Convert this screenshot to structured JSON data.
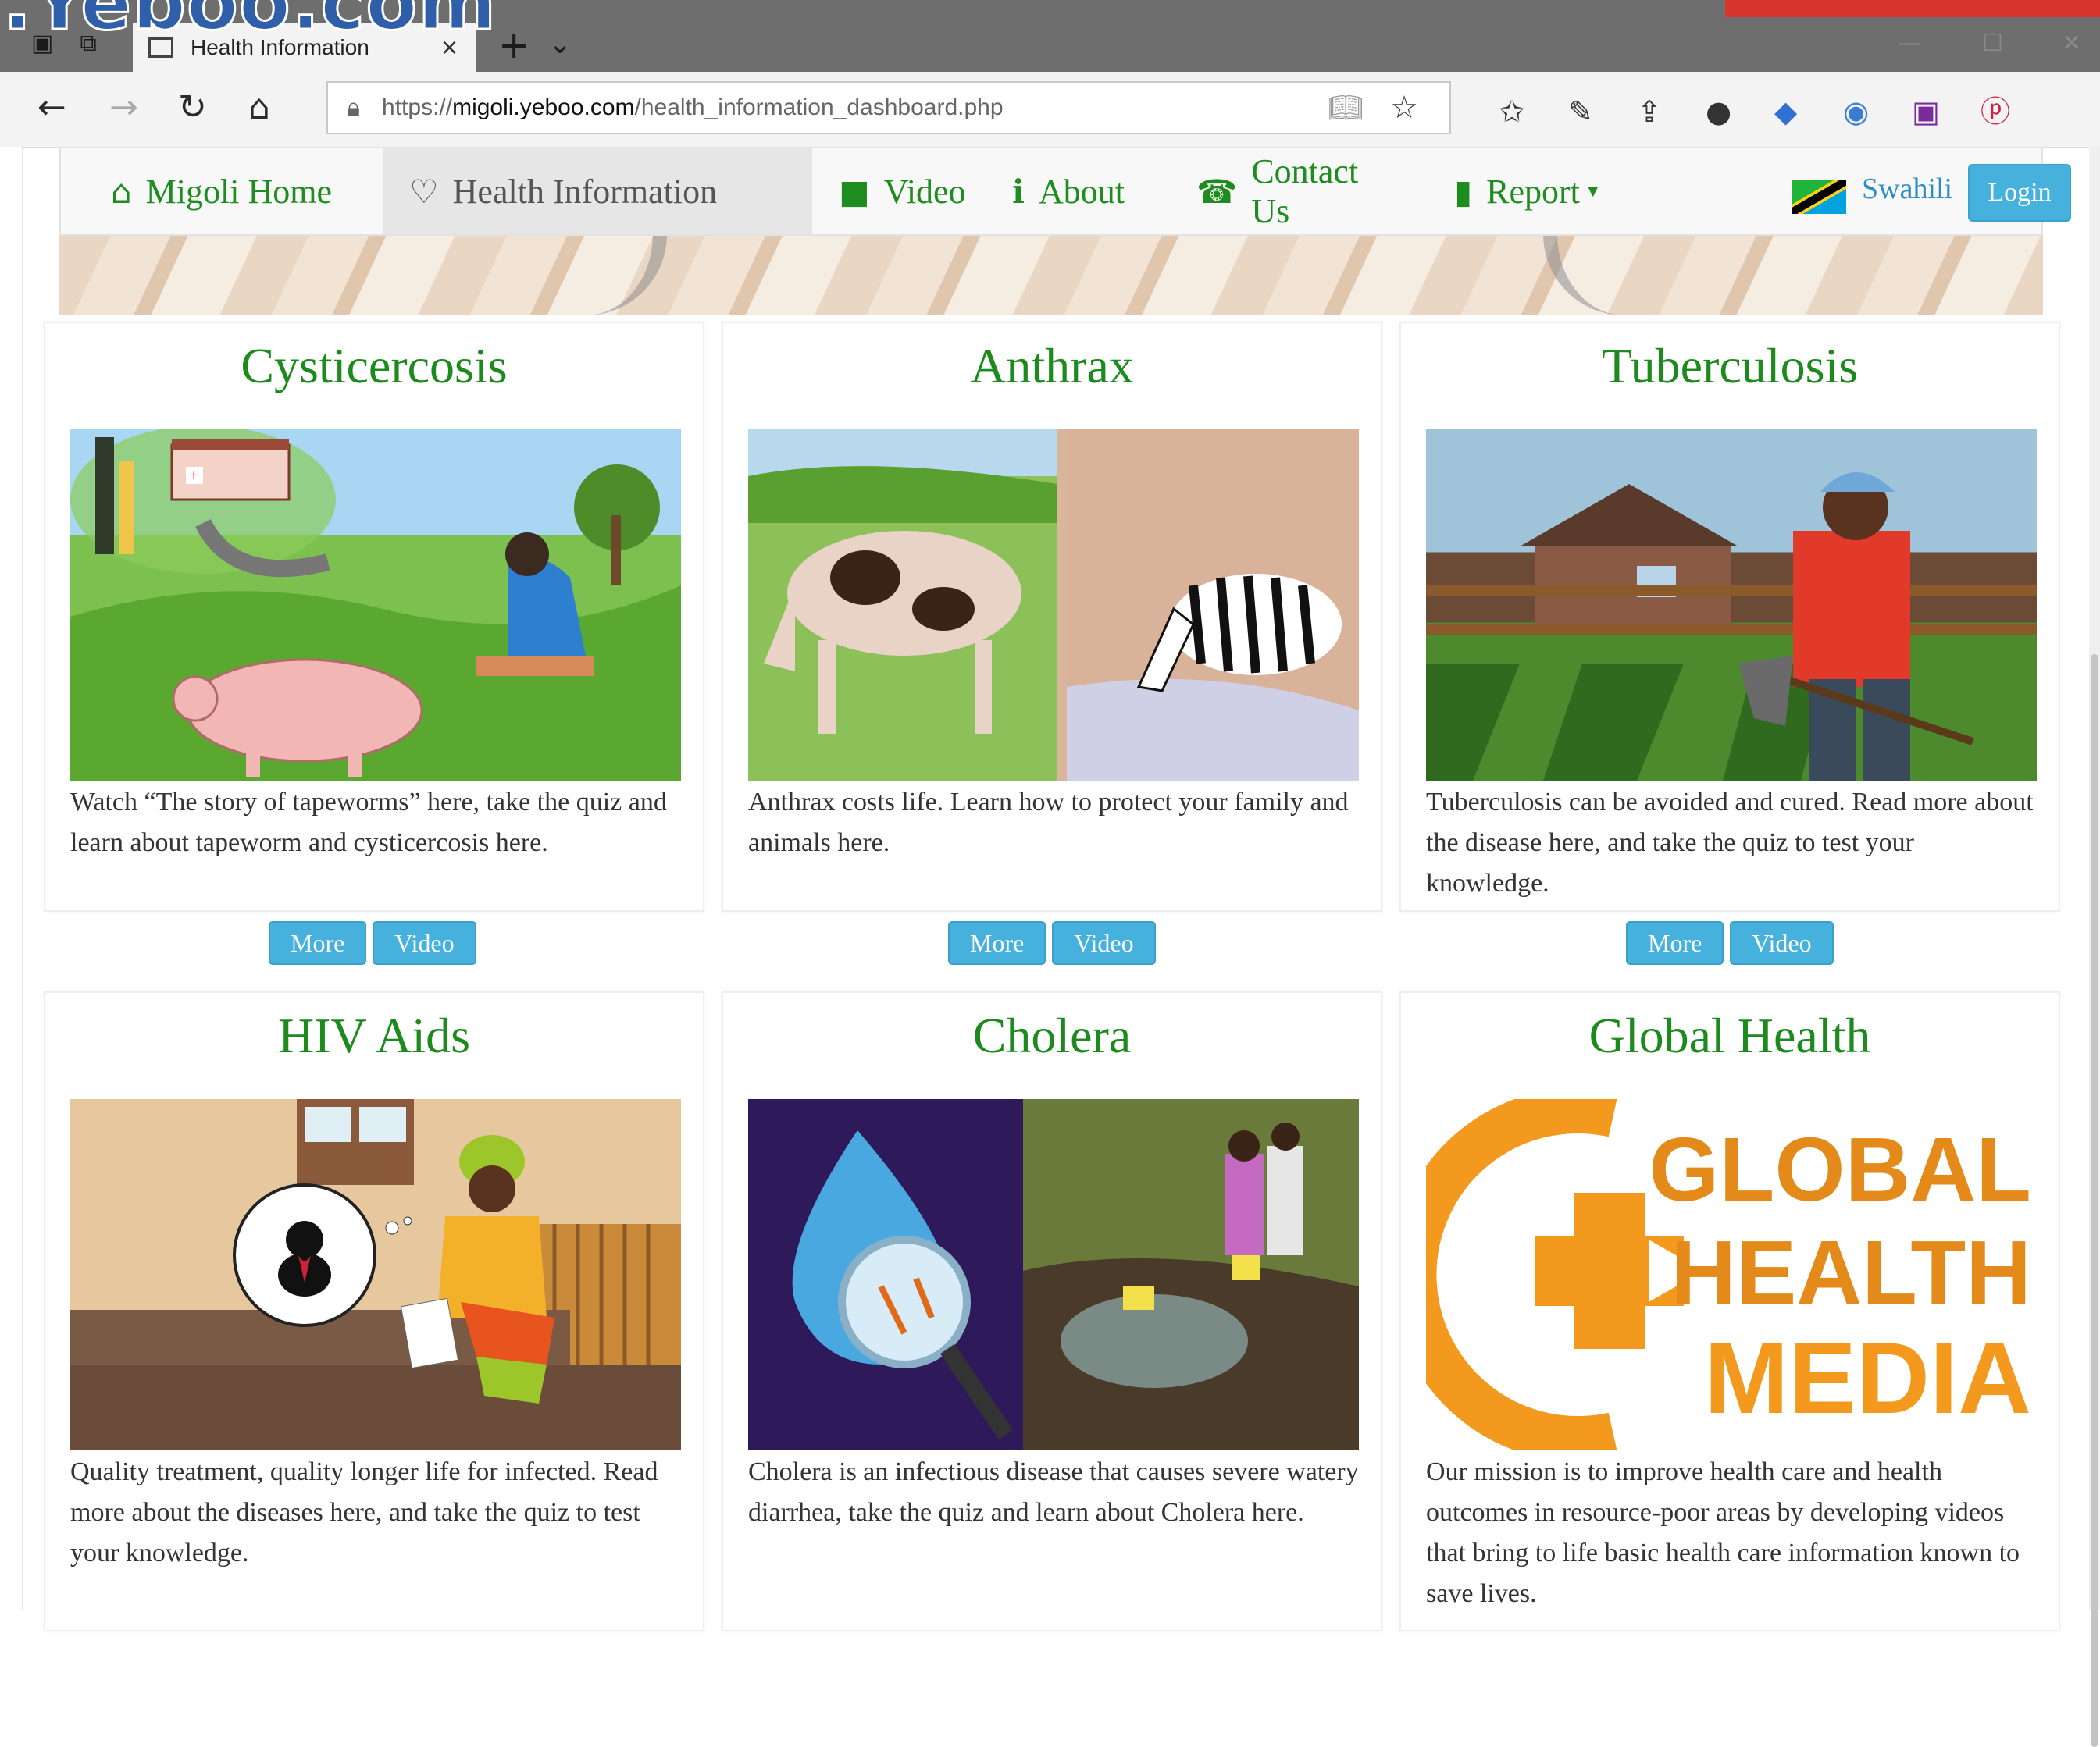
{
  "watermark": "i.Yeboo.com",
  "browser": {
    "tab_title": "Health Information",
    "url_prefix": "https://",
    "url_host": "migoli.yeboo.com",
    "url_path": "/health_information_dashboard.php"
  },
  "nav": {
    "home": "Migoli Home",
    "health": "Health Information",
    "video": "Video",
    "about": "About",
    "contact": "Contact Us",
    "report": "Report",
    "language": "Swahili",
    "login": "Login"
  },
  "cards": [
    {
      "title": "Cysticercosis",
      "description": "Watch “The story of tapeworms” here, take the quiz and learn about tapeworm and cysticercosis here.",
      "more": "More",
      "video": "Video"
    },
    {
      "title": "Anthrax",
      "description": "Anthrax costs life. Learn how to protect your family and animals here.",
      "more": "More",
      "video": "Video"
    },
    {
      "title": "Tuberculosis",
      "description": "Tuberculosis can be avoided and cured. Read more about the disease here, and take the quiz to test your knowledge.",
      "more": "More",
      "video": "Video"
    },
    {
      "title": "HIV Aids",
      "description": "Quality treatment, quality longer life for infected. Read more about the diseases here, and take the quiz to test your knowledge."
    },
    {
      "title": "Cholera",
      "description": "Cholera is an infectious disease that causes severe watery diarrhea, take the quiz and learn about Cholera here."
    },
    {
      "title": "Global Health",
      "description": "Our mission is to improve health care and health outcomes in resource-poor areas by developing videos that bring to life basic health care information known to save lives.",
      "logo_text": [
        "GLOBAL",
        "HEALTH",
        "MEDIA"
      ]
    }
  ],
  "colors": {
    "title_green": "#1d8a1d",
    "button_blue": "#47b1dd",
    "logo_orange": "#f39a1e"
  }
}
